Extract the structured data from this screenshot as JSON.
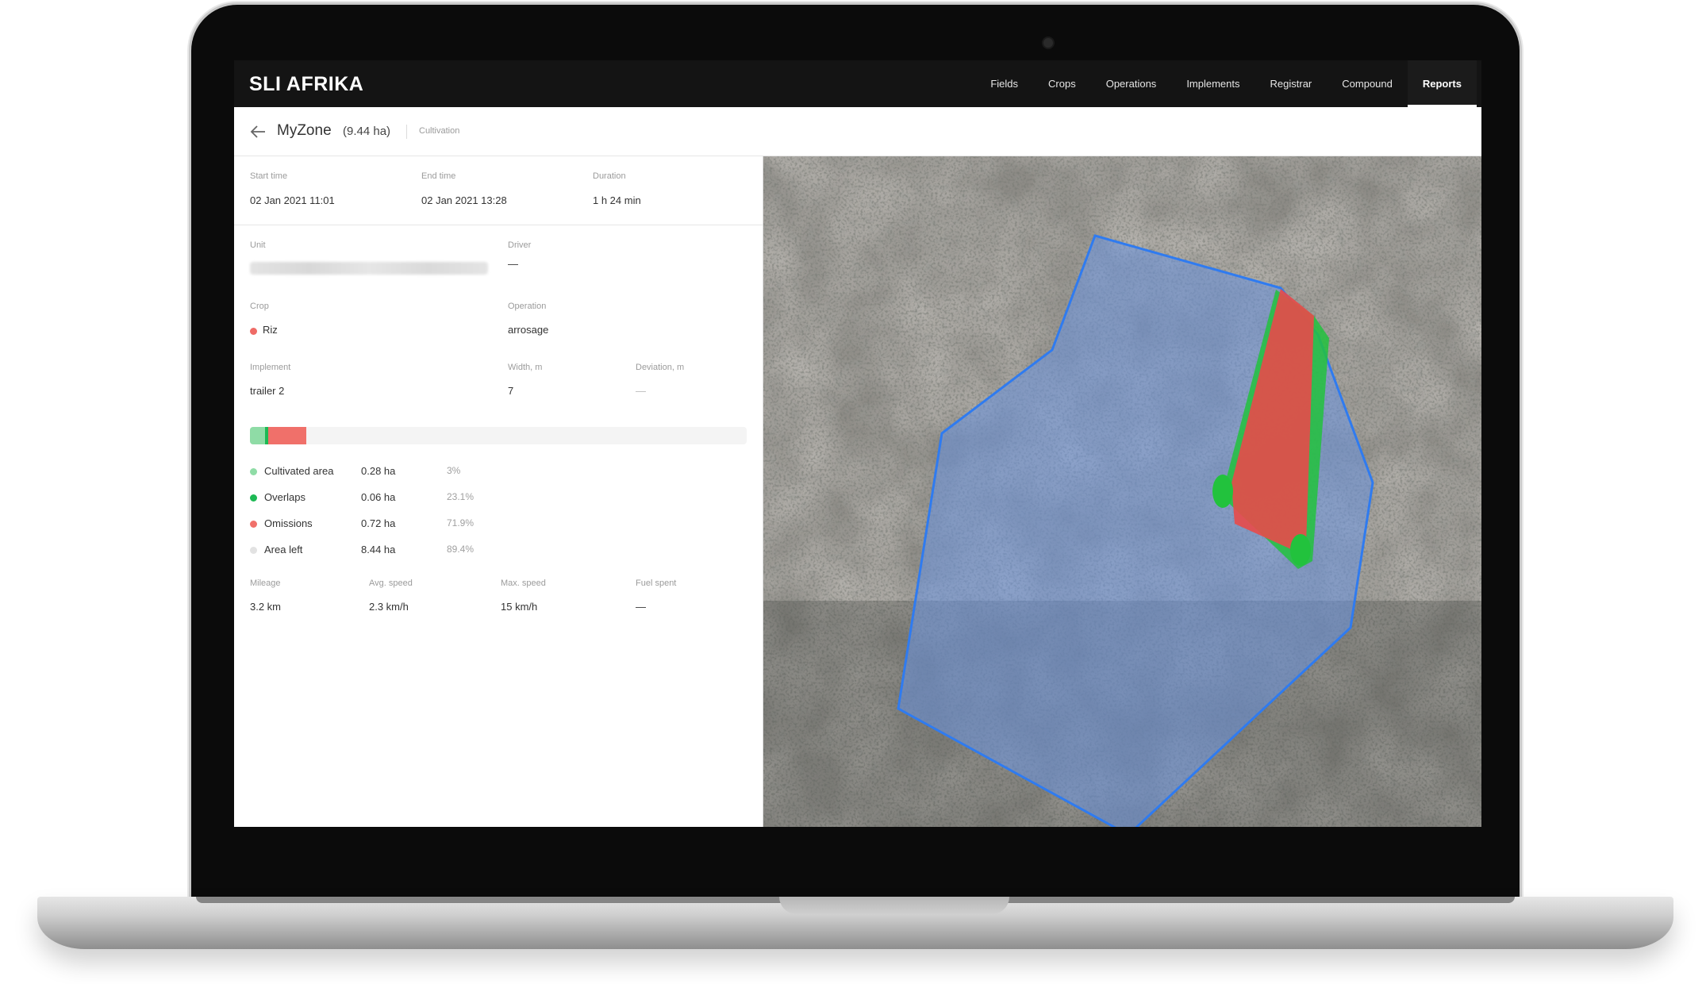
{
  "brand": "SLI AFRIKA",
  "nav": [
    "Fields",
    "Crops",
    "Operations",
    "Implements",
    "Registrar",
    "Compound",
    "Reports"
  ],
  "nav_active": "Reports",
  "zone": {
    "name": "MyZone",
    "area": "(9.44 ha)",
    "type": "Cultivation"
  },
  "times": {
    "start_label": "Start time",
    "start_value": "02 Jan 2021 11:01",
    "end_label": "End time",
    "end_value": "02 Jan 2021 13:28",
    "duration_label": "Duration",
    "duration_value": "1 h 24 min"
  },
  "details": {
    "unit_label": "Unit",
    "driver_label": "Driver",
    "driver_value": "—",
    "crop_label": "Crop",
    "crop_value": "Riz",
    "operation_label": "Operation",
    "operation_value": "arrosage",
    "implement_label": "Implement",
    "implement_value": "trailer 2",
    "width_label": "Width, m",
    "width_value": "7",
    "deviation_label": "Deviation, m",
    "deviation_value": "—"
  },
  "coverage": [
    {
      "name": "Cultivated area",
      "amount": "0.28 ha",
      "percent": "3%",
      "color": "#8fdca6"
    },
    {
      "name": "Overlaps",
      "amount": "0.06 ha",
      "percent": "23.1%",
      "color": "#1db954"
    },
    {
      "name": "Omissions",
      "amount": "0.72 ha",
      "percent": "71.9%",
      "color": "#f0706a"
    },
    {
      "name": "Area left",
      "amount": "8.44 ha",
      "percent": "89.4%",
      "color": "#e2e2e2"
    }
  ],
  "stats": {
    "mileage_label": "Mileage",
    "mileage_value": "3.2 km",
    "avg_label": "Avg. speed",
    "avg_value": "2.3 km/h",
    "max_label": "Max. speed",
    "max_value": "15 km/h",
    "fuel_label": "Fuel spent",
    "fuel_value": "—"
  },
  "colors": {
    "header_bg": "#141414",
    "zone_outline": "#2f7bf0",
    "zone_fill": "#6a94e0",
    "track_fill": "#e84a4a",
    "overlap_fill": "#22c23d"
  }
}
